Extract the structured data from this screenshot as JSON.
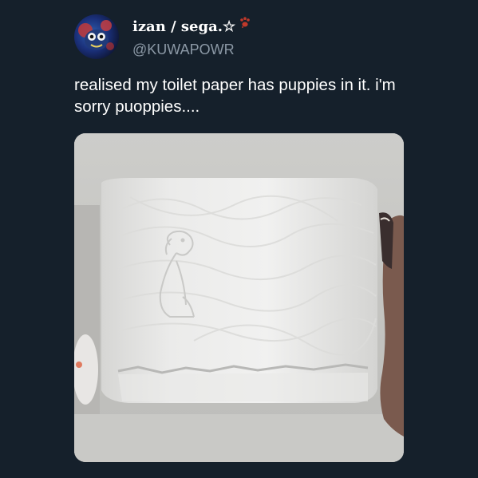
{
  "user": {
    "display_name": "izan / sega.☆",
    "handle": "@KUWAPOWR",
    "avatar_icon": "avatar-icon",
    "badge_icon": "paw-print-icon",
    "badge_color": "#c0392b"
  },
  "tweet": {
    "text": "realised my toilet paper has puppies in it. i'm sorry puoppies...."
  },
  "media": {
    "type": "photo",
    "subject": "toilet-paper-roll-photo"
  },
  "colors": {
    "background": "#15202b",
    "text_primary": "#ffffff",
    "text_secondary": "#8b98a5"
  }
}
